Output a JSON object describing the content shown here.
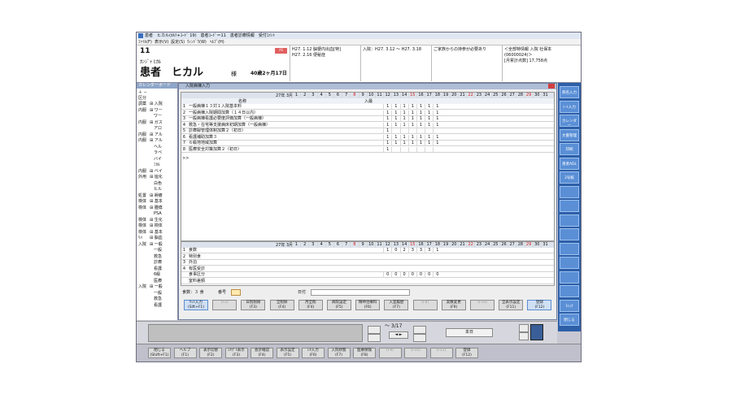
{
  "titlebar": {
    "text": "患者　ヒカル(ｶﾙﾃ+ｺｰﾄﾞ 19)　患者ｺｰﾄﾞ＝11　患者診療情報　受付ｺﾒﾝﾄ"
  },
  "menu": [
    "ﾌｧｲﾙ(F)",
    "表示(V)",
    "設定(S)",
    "ｳｨﾝﾄﾞｳ(W)",
    "ﾍﾙﾌﾟ(H)"
  ],
  "patient": {
    "number": "11",
    "kana": "ｶﾝｼﾞｬ ﾋｶﾙ",
    "name": "患者　ヒカル",
    "honorific": "様",
    "age": "40歳2ヶ月17日"
  },
  "header": {
    "badge": "ﾒﾓ",
    "col1_line1": "H27. 1.12 脳梗内出血[特]",
    "col1_line2": "H27. 2.16 便秘症",
    "col2": "入院：H27. 3.12 ～ H27. 3.18",
    "col3": "ご家族からの持参が必要あり",
    "col4_line1": "＜全部特情報 入院 社保本",
    "col4_line2": "(06000024)＞",
    "col4_line3": "[月累計点数] 17,758点"
  },
  "left_panel": {
    "title": "カレンダーボード",
    "header": "区分",
    "rows": [
      {
        "kubun": "調薬",
        "item": "⊞ 入院"
      },
      {
        "kubun": "内服",
        "item": "⊞ ワー"
      },
      {
        "kubun": "",
        "item": "　ワー"
      },
      {
        "kubun": "内服",
        "item": "⊞ ガス"
      },
      {
        "kubun": "",
        "item": "　アロ"
      },
      {
        "kubun": "内服",
        "item": "⊞ アル"
      },
      {
        "kubun": "内服",
        "item": "⊞ アル"
      },
      {
        "kubun": "",
        "item": "　ヘル"
      },
      {
        "kubun": "",
        "item": "　ラペ"
      },
      {
        "kubun": "",
        "item": "　バイ"
      },
      {
        "kubun": "",
        "item": "　ﾐｶﾙ"
      },
      {
        "kubun": "内服",
        "item": "⊞ ベイ"
      },
      {
        "kubun": "外用",
        "item": "⊞ 塩化"
      },
      {
        "kubun": "",
        "item": "　白色"
      },
      {
        "kubun": "",
        "item": "　ヒル"
      },
      {
        "kubun": "処置",
        "item": "⊞ 褥瘡"
      },
      {
        "kubun": "検体",
        "item": "⊞ 基本"
      },
      {
        "kubun": "検体",
        "item": "⊞ 腫瘍"
      },
      {
        "kubun": "",
        "item": "　PSA"
      },
      {
        "kubun": "検体",
        "item": "⊞ 生化"
      },
      {
        "kubun": "検体",
        "item": "⊞ 検体"
      },
      {
        "kubun": "検体",
        "item": "⊞ 基本"
      },
      {
        "kubun": "ﾘﾊ",
        "item": "⊞ 脳血"
      },
      {
        "kubun": "入院",
        "item": "⊞ 一般"
      },
      {
        "kubun": "",
        "item": "　一般"
      },
      {
        "kubun": "",
        "item": "　救急"
      },
      {
        "kubun": "",
        "item": "　診療"
      },
      {
        "kubun": "",
        "item": "　看護"
      },
      {
        "kubun": "",
        "item": "　6級"
      },
      {
        "kubun": "",
        "item": "　医療"
      },
      {
        "kubun": "入院",
        "item": "⊞ 一般"
      },
      {
        "kubun": "",
        "item": "　一般"
      },
      {
        "kubun": "",
        "item": "　救急"
      },
      {
        "kubun": "",
        "item": "　看護"
      }
    ]
  },
  "main": {
    "title": "入院病棟入力",
    "month_label": "27年 3月",
    "name_header": "名称",
    "days": [
      "1",
      "2",
      "3",
      "4",
      "5",
      "6",
      "7",
      "8",
      "9",
      "10",
      "11",
      "12",
      "13",
      "14",
      "15",
      "16",
      "17",
      "18",
      "19",
      "20",
      "21",
      "22",
      "23",
      "24",
      "25",
      "26",
      "27",
      "28",
      "29",
      "30",
      "31"
    ],
    "sub_header": "入最",
    "top_rows": [
      {
        "no": "1",
        "name": "一般病棟１３対１入院基本料"
      },
      {
        "no": "2",
        "name": "一般病棟入院期間加算（１４日以内）"
      },
      {
        "no": "3",
        "name": "一般病棟看護必要度評価加算（一般病棟）"
      },
      {
        "no": "4",
        "name": "救急・在宅等支援病床初期加算（一般病棟）"
      },
      {
        "no": "5",
        "name": "診療録管理体制加算２（初日）"
      },
      {
        "no": "6",
        "name": "看護補助加算３"
      },
      {
        "no": "7",
        "name": "６級地地域加算"
      },
      {
        "no": "8",
        "name": "医療安全対策加算２（初日）"
      }
    ],
    "top_marks": [
      [
        "1",
        "1",
        "1",
        "1",
        "1",
        "1",
        "1"
      ],
      [
        "1",
        "1",
        "1",
        "1",
        "1",
        "1",
        "1"
      ],
      [
        "1",
        "1",
        "1",
        "1",
        "1",
        "1",
        "1"
      ],
      [
        "1",
        "1",
        "1",
        "1",
        "1",
        "1",
        "1"
      ],
      [
        "1",
        "",
        "",
        "",
        "",
        "",
        ""
      ],
      [
        "1",
        "1",
        "1",
        "1",
        "1",
        "1",
        "1"
      ],
      [
        "1",
        "1",
        "1",
        "1",
        "1",
        "1",
        "1"
      ],
      [
        "1",
        "",
        "",
        "",
        "",
        "",
        ""
      ]
    ],
    "bottom_rows": [
      {
        "no": "1",
        "name": "食数"
      },
      {
        "no": "2",
        "name": "特別食"
      },
      {
        "no": "3",
        "name": "外泊"
      },
      {
        "no": "4",
        "name": "有医受診"
      },
      {
        "no": "",
        "name": "食事区分"
      },
      {
        "no": "",
        "name": "室料差額"
      }
    ],
    "bottom_marks_row1": [
      "1",
      "0",
      "2",
      "3",
      "3",
      "3",
      "1"
    ],
    "bottom_marks_row5": [
      "0",
      "0",
      "0",
      "0",
      "0",
      "0",
      "0"
    ],
    "meal_info": "食数：３ 食",
    "seq_label": "番号",
    "date_label": "日付"
  },
  "fbuttons": [
    {
      "t": "ｾｯﾄ入力",
      "k": "(Sift+F1)",
      "s": "blue"
    },
    {
      "t": "",
      "k": "(F2)",
      "s": "dis"
    },
    {
      "t": "日別削除",
      "k": "(F3)",
      "s": ""
    },
    {
      "t": "全削除",
      "k": "(F4)",
      "s": ""
    },
    {
      "t": "月全削",
      "k": "(F4)",
      "s": ""
    },
    {
      "t": "病院設定",
      "k": "(F5)",
      "s": ""
    },
    {
      "t": "精神治療料",
      "k": "(F6)",
      "s": ""
    },
    {
      "t": "入室履歴",
      "k": "(F7)",
      "s": ""
    },
    {
      "t": "",
      "k": "(F8)",
      "s": "dis"
    },
    {
      "t": "実数変更",
      "k": "(F9)",
      "s": ""
    },
    {
      "t": "",
      "k": "(F10)",
      "s": "dis"
    },
    {
      "t": "全表示設定",
      "k": "(F11)",
      "s": ""
    },
    {
      "t": "登録",
      "k": "(F12)",
      "s": "blue"
    }
  ],
  "nav": {
    "page": "3/17",
    "today": "本日"
  },
  "bottom_fkeys": [
    {
      "t": "閉じる",
      "k": "(Shift+F1)"
    },
    {
      "t": "ヘルプ",
      "k": "(F1)"
    },
    {
      "t": "表示切替",
      "k": "(F2)"
    },
    {
      "t": "ﾚｾﾌﾟﾄ表示",
      "k": "(F3)"
    },
    {
      "t": "会計確認",
      "k": "(F4)"
    },
    {
      "t": "表示設定",
      "k": "(F5)"
    },
    {
      "t": "ﾚｾ入力",
      "k": "(F6)"
    },
    {
      "t": "入院状態",
      "k": "(F7)"
    },
    {
      "t": "医療保険",
      "k": "(F8)"
    },
    {
      "t": "",
      "k": "(F9)"
    },
    {
      "t": "",
      "k": "(F10)"
    },
    {
      "t": "",
      "k": "(F11)"
    },
    {
      "t": "登録",
      "k": "(F12)"
    }
  ],
  "right_buttons": [
    {
      "t": "病名入力"
    },
    {
      "t": "ｼｰﾄ入力"
    },
    {
      "t": "カレンダー"
    },
    {
      "t": "文書管理"
    },
    {
      "t": "印刷"
    },
    {
      "t": "患者ADL"
    },
    {
      "t": "2号紙"
    },
    {
      "t": ""
    },
    {
      "t": ""
    },
    {
      "t": ""
    },
    {
      "t": ""
    },
    {
      "t": ""
    },
    {
      "t": ""
    },
    {
      "t": ""
    },
    {
      "t": ""
    },
    {
      "t": "ﾁｪｯｸ"
    },
    {
      "t": "閉じる"
    }
  ]
}
